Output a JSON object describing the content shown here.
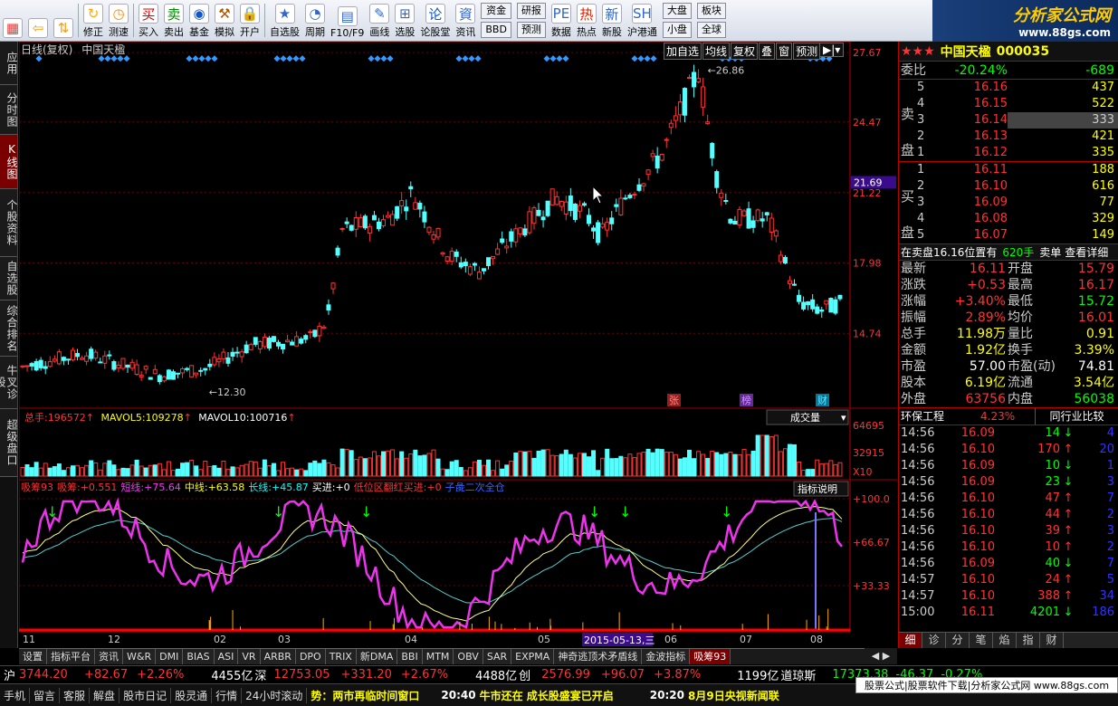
{
  "toolbar": {
    "buttons": [
      {
        "id": "win",
        "label": "",
        "icon": "windows-icon"
      },
      {
        "id": "back",
        "label": "",
        "icon": "back-arrow-icon"
      },
      {
        "id": "updown",
        "label": "",
        "icon": "up-down-icon"
      },
      {
        "id": "revise",
        "label": "修正",
        "icon": "revise-icon"
      },
      {
        "id": "measure",
        "label": "测速",
        "icon": "clock-icon"
      },
      {
        "id": "buy",
        "label": "买入",
        "icon": "buy-icon"
      },
      {
        "id": "sell",
        "label": "卖出",
        "icon": "sell-icon"
      },
      {
        "id": "fund",
        "label": "基金",
        "icon": "fund-icon"
      },
      {
        "id": "sim",
        "label": "模拟",
        "icon": "hammer-icon"
      },
      {
        "id": "open",
        "label": "开户",
        "icon": "lock-icon"
      },
      {
        "id": "fav",
        "label": "自选股",
        "icon": "star-icon"
      },
      {
        "id": "period",
        "label": "周期",
        "icon": "period-icon"
      },
      {
        "id": "f10",
        "label": "F10/F9",
        "icon": "f10-icon"
      },
      {
        "id": "draw",
        "label": "画线",
        "icon": "pencil-icon"
      },
      {
        "id": "pick",
        "label": "选股",
        "icon": "pick-icon"
      },
      {
        "id": "forum",
        "label": "论股堂",
        "icon": "forum-icon"
      },
      {
        "id": "info",
        "label": "资讯",
        "icon": "info-icon"
      }
    ],
    "small": [
      [
        "资金",
        "BBD"
      ],
      [
        "研报",
        "预测"
      ]
    ],
    "buttons2": [
      {
        "id": "data",
        "label": "数据",
        "icon": "pe-icon"
      },
      {
        "id": "hot",
        "label": "热点",
        "icon": "hot-icon"
      },
      {
        "id": "newshares",
        "label": "新股",
        "icon": "new-shares-icon"
      },
      {
        "id": "hk",
        "label": "沪港通",
        "icon": "sse-hk-icon"
      }
    ],
    "small2": [
      [
        "大盘",
        "小盘"
      ],
      [
        "板块",
        "全球"
      ]
    ]
  },
  "logo": {
    "title": "分析家公式网",
    "url": "www.88gs.com"
  },
  "left_tabs": [
    {
      "label": "应用",
      "active": false
    },
    {
      "label": "分时图",
      "active": false
    },
    {
      "label": "K线图",
      "active": true
    },
    {
      "label": "个股资料",
      "active": false
    },
    {
      "label": "自选股",
      "active": false
    },
    {
      "label": "综合排名",
      "active": false
    },
    {
      "label": "牛叉诊股",
      "active": false
    },
    {
      "label": "超级盘口",
      "active": false
    }
  ],
  "kline": {
    "title": "日线(复权)",
    "name": "中国天楹",
    "buttons": [
      "加自选",
      "均线",
      "复权",
      "叠",
      "窗",
      "预测"
    ],
    "yticks": [
      "27.67",
      "24.47",
      "21.22",
      "17.98",
      "14.74"
    ],
    "current": "21.69",
    "high": "26.86",
    "low": "12.30",
    "events": [
      "张",
      "榜",
      "财"
    ]
  },
  "volume": {
    "label1": "总手:",
    "v1": "196572",
    "label2": "MAVOL5:",
    "v2": "109278",
    "label3": "MAVOL10:",
    "v3": "100716",
    "selector": "成交量",
    "yticks": [
      "64695",
      "32915",
      "X10"
    ]
  },
  "indicator": {
    "name": "吸筹93",
    "items": [
      [
        "吸筹:",
        "+0.551"
      ],
      [
        "短线:",
        "+75.64"
      ],
      [
        "中线:",
        "+63.58"
      ],
      [
        "长线:",
        "+45.87"
      ],
      [
        "买进:",
        "+0"
      ],
      [
        "低位区翻红买进:",
        "+0"
      ],
      [
        "子彘二次全仓",
        ""
      ]
    ],
    "explain": "指标说明",
    "yticks": [
      "+100.0",
      "+66.67",
      "+33.33"
    ],
    "xlabels": [
      "11",
      "12",
      "02",
      "03",
      "04",
      "05",
      "06",
      "07",
      "08"
    ],
    "date_tag": "2015-05-13,三"
  },
  "bottom_tabs": [
    {
      "label": "设置",
      "active": false
    },
    {
      "label": "指标平台",
      "active": false
    },
    {
      "label": "资讯",
      "active": false
    },
    {
      "label": "W&R",
      "active": false
    },
    {
      "label": "DMI",
      "active": false
    },
    {
      "label": "BIAS",
      "active": false
    },
    {
      "label": "ASI",
      "active": false
    },
    {
      "label": "VR",
      "active": false
    },
    {
      "label": "ARBR",
      "active": false
    },
    {
      "label": "DPO",
      "active": false
    },
    {
      "label": "TRIX",
      "active": false
    },
    {
      "label": "新DMA",
      "active": false
    },
    {
      "label": "BBI",
      "active": false
    },
    {
      "label": "MTM",
      "active": false
    },
    {
      "label": "OBV",
      "active": false
    },
    {
      "label": "SAR",
      "active": false
    },
    {
      "label": "EXPMA",
      "active": false
    },
    {
      "label": "神奇逃顶术矛盾线",
      "active": false
    },
    {
      "label": "金波指标",
      "active": false
    },
    {
      "label": "吸筹93",
      "active": true
    }
  ],
  "quote": {
    "stars": "★★★",
    "name": "中国天楹",
    "code": "000035",
    "weibi": {
      "label": "委比",
      "v": "-20.24%",
      "d": "-689"
    },
    "sell": [
      [
        "5",
        "16.16",
        "437"
      ],
      [
        "4",
        "16.15",
        "522"
      ],
      [
        "3",
        "16.14",
        "333"
      ],
      [
        "2",
        "16.13",
        "421"
      ],
      [
        "1",
        "16.12",
        "335"
      ]
    ],
    "buy": [
      [
        "1",
        "16.11",
        "188"
      ],
      [
        "2",
        "16.10",
        "616"
      ],
      [
        "3",
        "16.09",
        "77"
      ],
      [
        "4",
        "16.08",
        "329"
      ],
      [
        "5",
        "16.07",
        "149"
      ]
    ],
    "sell_label": "卖盘",
    "buy_label": "买盘",
    "order_line": {
      "text": "在卖盘16.16位置有",
      "qty": "620手",
      "link1": "卖单",
      "link2": "查看详细"
    },
    "stats": [
      [
        "最新",
        "16.11",
        "开盘",
        "15.79"
      ],
      [
        "涨跌",
        "+0.53",
        "最高",
        "16.17"
      ],
      [
        "涨幅",
        "+3.40%",
        "最低",
        "15.72"
      ],
      [
        "振幅",
        "2.89%",
        "均价",
        "16.01"
      ],
      [
        "总手",
        "11.98万",
        "量比",
        "0.91"
      ],
      [
        "金额",
        "1.92亿",
        "换手",
        "3.39%"
      ],
      [
        "市盈",
        "57.00",
        "市盈(动)",
        "74.81"
      ],
      [
        "股本",
        "6.19亿",
        "流通",
        "3.54亿"
      ],
      [
        "外盘",
        "63756",
        "内盘",
        "56038"
      ]
    ],
    "industry": {
      "name": "环保工程",
      "pct": "4.23%",
      "btn": "同行业比较"
    },
    "ticks": [
      [
        "14:56",
        "16.09",
        "14",
        "↓",
        "4"
      ],
      [
        "14:56",
        "16.10",
        "170",
        "↑",
        "20"
      ],
      [
        "14:56",
        "16.09",
        "10",
        "↓",
        "1"
      ],
      [
        "14:56",
        "16.09",
        "23",
        "↓",
        "3"
      ],
      [
        "14:56",
        "16.10",
        "47",
        "↑",
        "7"
      ],
      [
        "14:56",
        "16.10",
        "44",
        "↑",
        "2"
      ],
      [
        "14:56",
        "16.10",
        "39",
        "↑",
        "3"
      ],
      [
        "14:56",
        "16.10",
        "10",
        "↑",
        "2"
      ],
      [
        "14:56",
        "16.09",
        "40",
        "↓",
        "7"
      ],
      [
        "14:57",
        "16.10",
        "24",
        "↑",
        "5"
      ],
      [
        "14:57",
        "16.10",
        "388",
        "↑",
        "34"
      ],
      [
        "15:00",
        "16.11",
        "4201",
        "↓",
        "186"
      ]
    ],
    "tabs": [
      "细",
      "诊",
      "分",
      "笔",
      "焰",
      "指",
      "财"
    ]
  },
  "ticker": {
    "sh": "沪",
    "shv": "3744.20",
    "shd": "+82.67",
    "shp": "+2.26%",
    "sha": "4455亿",
    "sz": "深",
    "szv": "12753.05",
    "szd": "+331.20",
    "szp": "+2.67%",
    "sza": "4488亿",
    "cy": "创",
    "cyv": "2576.99",
    "cyd": "+96.07",
    "cyp": "+3.87%",
    "cya": "1199亿",
    "dj": "道琼斯",
    "djv": "17373.38",
    "djd": "-46.37",
    "djp": "-0.27%"
  },
  "status": {
    "items": [
      "手机",
      "留言",
      "客服",
      "解盘",
      "股市日记",
      "股灵通",
      "行情",
      "24小时滚动"
    ],
    "news1": "势：两市再临时间窗口",
    "t2": "20:40",
    "news2": "牛市还在 成长股盛宴已开启",
    "t3": "20:20",
    "news3": "8月9日央视新闻联",
    "ad": "股票公式|股票软件下载|分析家公式网 www.88gs.com"
  }
}
